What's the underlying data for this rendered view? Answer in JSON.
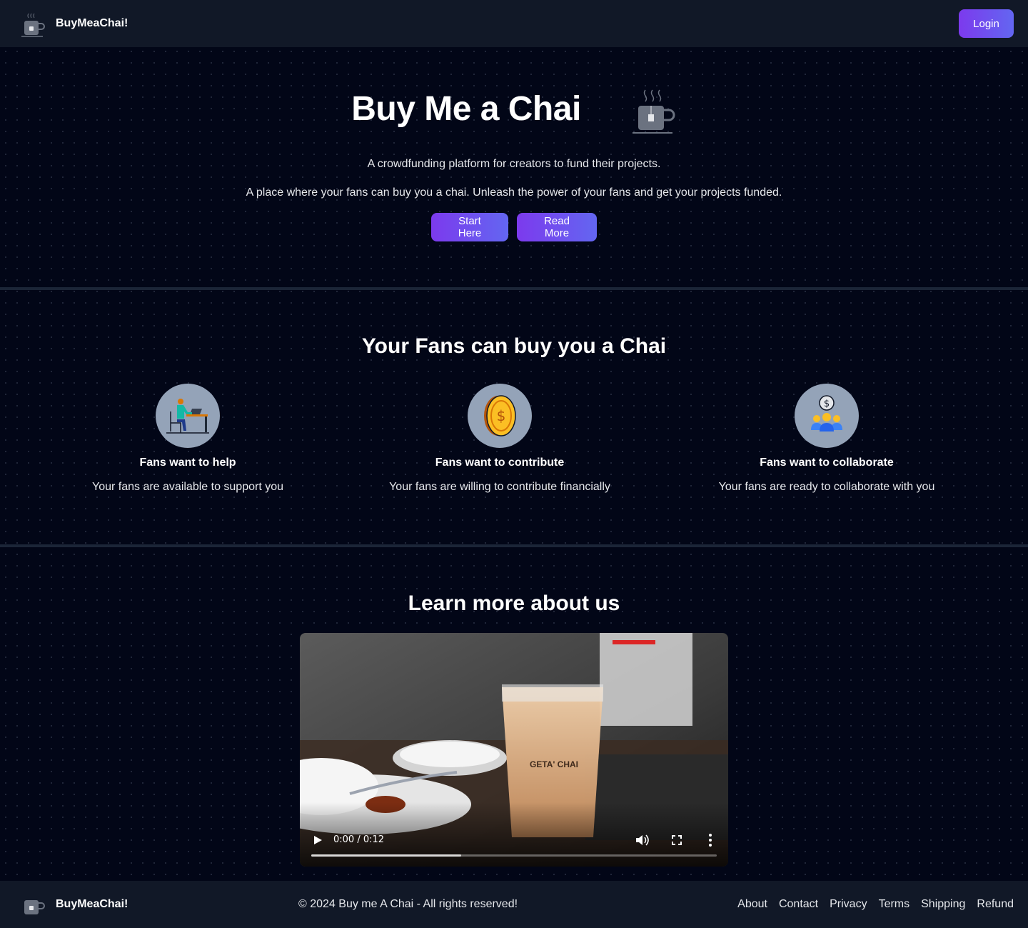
{
  "navbar": {
    "brand": "BuyMeaChai!",
    "logo_icon": "tea-cup-icon",
    "login_label": "Login"
  },
  "hero": {
    "title": "Buy Me a Chai",
    "cup_icon": "tea-cup-icon",
    "tagline": "A crowdfunding platform for creators to fund their projects.",
    "description": "A place where your fans can buy you a chai. Unleash the power of your fans and get your projects funded.",
    "start_label": "Start Here",
    "read_more_label": "Read More"
  },
  "fans": {
    "title": "Your Fans can buy you a Chai",
    "features": [
      {
        "icon": "person-at-desk-icon",
        "title": "Fans want to help",
        "description": "Your fans are available to support you"
      },
      {
        "icon": "gold-coin-icon",
        "title": "Fans want to contribute",
        "description": "Your fans are willing to contribute financially"
      },
      {
        "icon": "group-with-dollar-icon",
        "title": "Fans want to collaborate",
        "description": "Your fans are ready to collaborate with you"
      }
    ]
  },
  "learn": {
    "title": "Learn more about us",
    "video": {
      "time": "0:00 / 0:12",
      "cup_brand": "GETA' CHAI",
      "buffered_fraction": 0.37
    }
  },
  "footer": {
    "brand": "BuyMeaChai!",
    "copyright": "© 2024 Buy me A Chai - All rights reserved!",
    "links": [
      "About",
      "Contact",
      "Privacy",
      "Terms",
      "Shipping",
      "Refund"
    ]
  },
  "colors": {
    "background": "#020617",
    "navbar": "#111827",
    "button_gradient_start": "#7c3aed",
    "button_gradient_end": "#6366f1",
    "icon_circle": "#94a3b8"
  }
}
